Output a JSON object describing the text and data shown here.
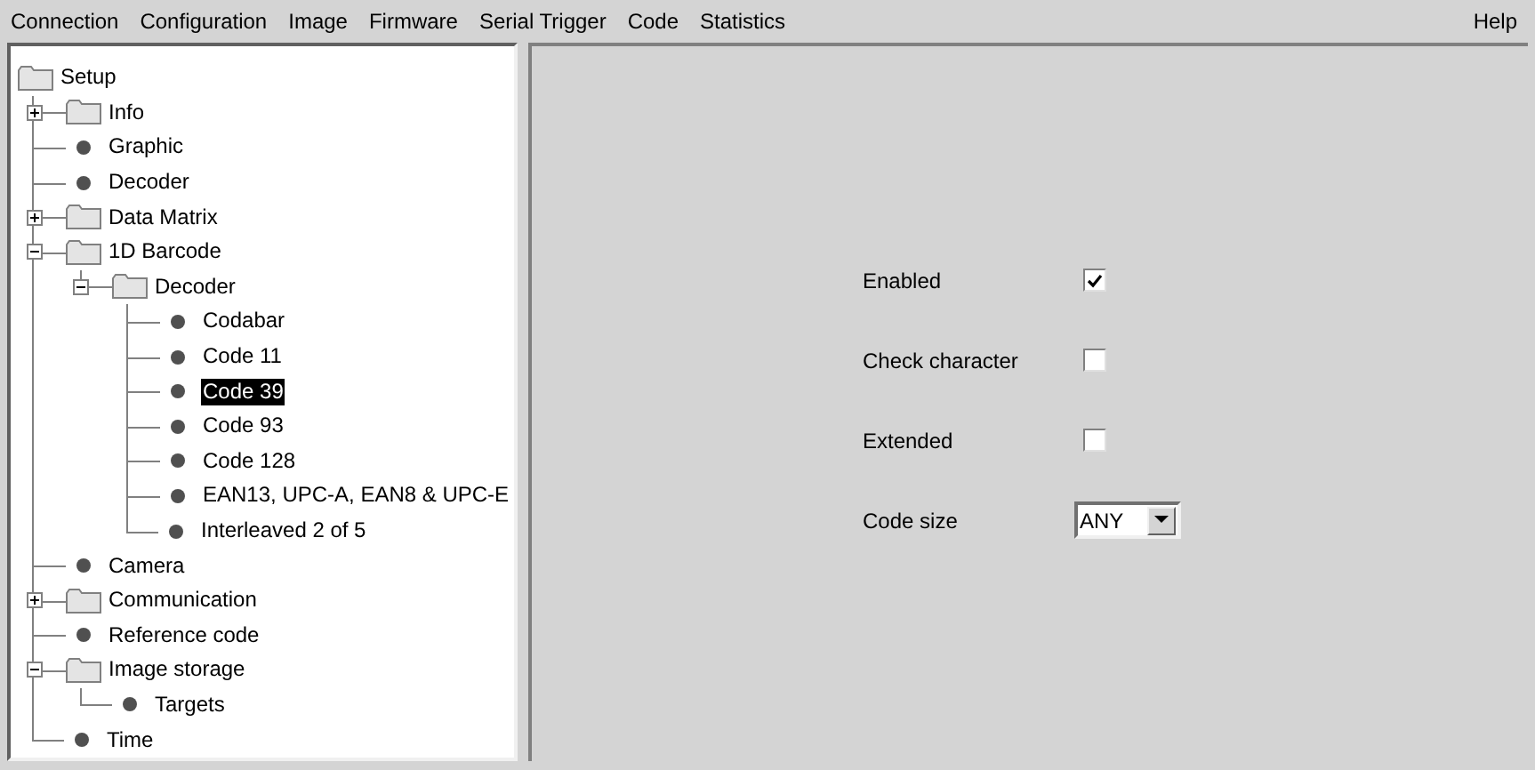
{
  "menu": {
    "items": [
      "Connection",
      "Configuration",
      "Image",
      "Firmware",
      "Serial Trigger",
      "Code",
      "Statistics"
    ],
    "help": "Help"
  },
  "tree": {
    "label": "Setup",
    "kind": "folder",
    "selected": false,
    "children": [
      {
        "label": "Info",
        "kind": "folder",
        "expanded": false,
        "selected": false
      },
      {
        "label": "Graphic",
        "kind": "leaf",
        "selected": false
      },
      {
        "label": "Decoder",
        "kind": "leaf",
        "selected": false
      },
      {
        "label": "Data Matrix",
        "kind": "folder",
        "expanded": false,
        "selected": false
      },
      {
        "label": "1D Barcode",
        "kind": "folder",
        "expanded": true,
        "selected": false,
        "children": [
          {
            "label": "Decoder",
            "kind": "folder",
            "expanded": true,
            "selected": false,
            "children": [
              {
                "label": "Codabar",
                "kind": "leaf",
                "selected": false
              },
              {
                "label": "Code 11",
                "kind": "leaf",
                "selected": false
              },
              {
                "label": "Code 39",
                "kind": "leaf",
                "selected": true
              },
              {
                "label": "Code 93",
                "kind": "leaf",
                "selected": false
              },
              {
                "label": "Code 128",
                "kind": "leaf",
                "selected": false
              },
              {
                "label": "EAN13, UPC-A, EAN8 & UPC-E",
                "kind": "leaf",
                "selected": false
              },
              {
                "label": "Interleaved 2 of 5",
                "kind": "leaf",
                "selected": false
              }
            ]
          }
        ]
      },
      {
        "label": "Camera",
        "kind": "leaf",
        "selected": false
      },
      {
        "label": "Communication",
        "kind": "folder",
        "expanded": false,
        "selected": false
      },
      {
        "label": "Reference code",
        "kind": "leaf",
        "selected": false
      },
      {
        "label": "Image storage",
        "kind": "folder",
        "expanded": true,
        "selected": false,
        "children": [
          {
            "label": "Targets",
            "kind": "leaf",
            "selected": false
          }
        ]
      },
      {
        "label": "Time",
        "kind": "leaf",
        "selected": false
      }
    ]
  },
  "settings": [
    {
      "label": "Enabled",
      "kind": "checkbox",
      "checked": true
    },
    {
      "label": "Check character",
      "kind": "checkbox",
      "checked": false
    },
    {
      "label": "Extended",
      "kind": "checkbox",
      "checked": false
    },
    {
      "label": "Code size",
      "kind": "dropdown",
      "value": "ANY"
    }
  ]
}
